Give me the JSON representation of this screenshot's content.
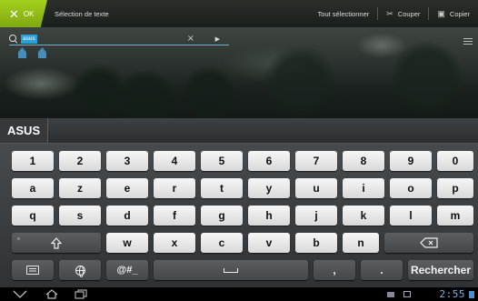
{
  "action_bar": {
    "ok_label": "OK",
    "title": "Sélection de texte",
    "select_all": "Tout sélectionner",
    "cut": "Couper",
    "copy": "Copier"
  },
  "search": {
    "value": "asus"
  },
  "suggestions": [
    "ASUS"
  ],
  "keyboard": {
    "row1": [
      "1",
      "2",
      "3",
      "4",
      "5",
      "6",
      "7",
      "8",
      "9",
      "0"
    ],
    "row2": [
      "a",
      "z",
      "e",
      "r",
      "t",
      "y",
      "u",
      "i",
      "o",
      "p"
    ],
    "row3": [
      "q",
      "s",
      "d",
      "f",
      "g",
      "h",
      "j",
      "k",
      "l",
      "m"
    ],
    "row4": [
      "w",
      "x",
      "c",
      "v",
      "b",
      "n"
    ],
    "symbols_label": "@#_",
    "comma": ",",
    "period": ".",
    "search_label": "Rechercher"
  },
  "status_bar": {
    "time": "2:55"
  },
  "colors": {
    "accent_green": "#99c31a",
    "selection_blue": "#2aa0d6",
    "clock_blue": "#7ab5e0"
  }
}
